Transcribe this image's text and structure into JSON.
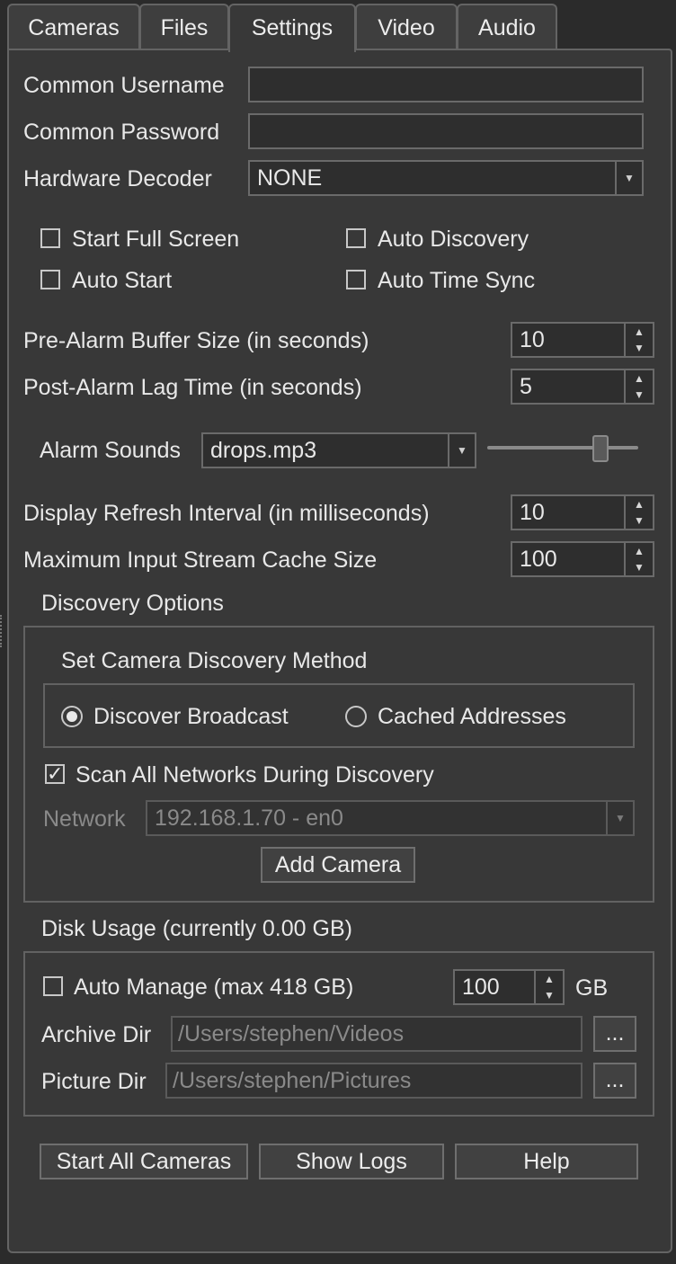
{
  "tabs": [
    {
      "label": "Cameras"
    },
    {
      "label": "Files"
    },
    {
      "label": "Settings"
    },
    {
      "label": "Video"
    },
    {
      "label": "Audio"
    }
  ],
  "active_tab": "Settings",
  "credentials": {
    "username_label": "Common Username",
    "username_value": "",
    "password_label": "Common Password",
    "password_value": "",
    "decoder_label": "Hardware Decoder",
    "decoder_value": "NONE"
  },
  "checkboxes": {
    "start_full_screen": {
      "label": "Start Full Screen",
      "checked": false
    },
    "auto_discovery": {
      "label": "Auto Discovery",
      "checked": false
    },
    "auto_start": {
      "label": "Auto Start",
      "checked": false
    },
    "auto_time_sync": {
      "label": "Auto Time Sync",
      "checked": false
    }
  },
  "alarm": {
    "pre_label": "Pre-Alarm Buffer Size (in seconds)",
    "pre_value": "10",
    "post_label": "Post-Alarm Lag Time (in seconds)",
    "post_value": "5",
    "sounds_label": "Alarm Sounds",
    "sounds_value": "drops.mp3",
    "volume_level": 0.78
  },
  "display": {
    "refresh_label": "Display Refresh Interval (in milliseconds)",
    "refresh_value": "10",
    "cache_label": "Maximum Input Stream Cache Size",
    "cache_value": "100"
  },
  "discovery": {
    "title": "Discovery Options",
    "method_title": "Set Camera Discovery Method",
    "broadcast_label": "Discover Broadcast",
    "broadcast_selected": true,
    "cached_label": "Cached Addresses",
    "scan_label": "Scan All Networks During Discovery",
    "scan_checked": true,
    "network_label": "Network",
    "network_value": "192.168.1.70 - en0",
    "add_camera_label": "Add Camera"
  },
  "disk": {
    "title": "Disk Usage (currently 0.00 GB)",
    "auto_manage_label": "Auto Manage (max 418 GB)",
    "auto_manage_checked": false,
    "size_value": "100",
    "unit": "GB",
    "archive_label": "Archive Dir",
    "archive_value": "/Users/stephen/Videos",
    "picture_label": "Picture Dir",
    "picture_value": "/Users/stephen/Pictures",
    "browse_label": "..."
  },
  "buttons": {
    "start_all": "Start All Cameras",
    "show_logs": "Show Logs",
    "help": "Help"
  },
  "colors": {
    "background": "#2b2b2b",
    "panel": "#383838",
    "border": "#646464",
    "text": "#e8e8e8",
    "disabled_text": "#8a8a8a"
  }
}
